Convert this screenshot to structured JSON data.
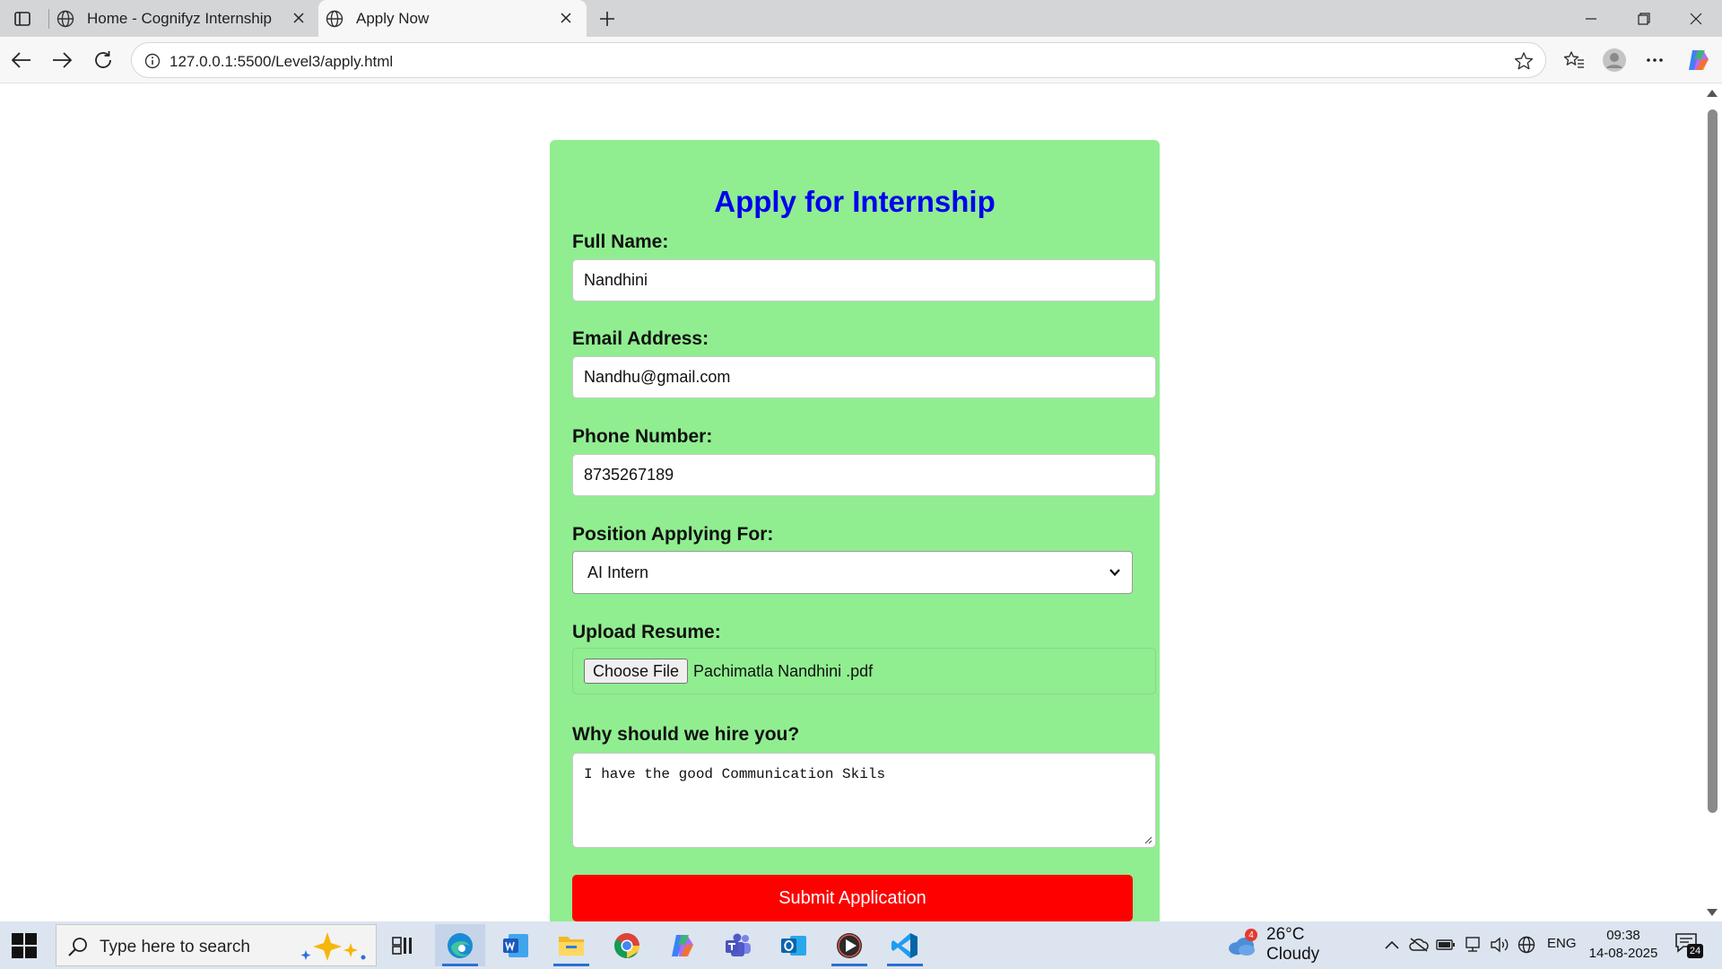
{
  "browser": {
    "tabs": [
      {
        "title": "Home - Cognifyz Internship",
        "icon": "globe-icon",
        "active": false
      },
      {
        "title": "Apply Now",
        "icon": "globe-icon",
        "active": true
      }
    ],
    "url": "127.0.0.1:5500/Level3/apply.html"
  },
  "form": {
    "title": "Apply for Internship",
    "full_name_label": "Full Name:",
    "full_name_value": "Nandhini",
    "email_label": "Email Address:",
    "email_value": "Nandhu@gmail.com",
    "phone_label": "Phone Number:",
    "phone_value": "8735267189",
    "position_label": "Position Applying For:",
    "position_value": "AI Intern",
    "resume_label": "Upload Resume:",
    "resume_button": "Choose File",
    "resume_file": "Pachimatla Nandhini .pdf",
    "why_label": "Why should we hire you?",
    "why_value": "I have the good Communication Skils",
    "submit_label": "Submit Application",
    "colors": {
      "card": "#90ee90",
      "title": "#0000ee",
      "submit": "#ff0000"
    }
  },
  "taskbar": {
    "search_placeholder": "Type here to search",
    "weather_badge": "4",
    "weather": "26°C  Cloudy",
    "language": "ENG",
    "time": "09:38",
    "date": "14-08-2025",
    "notification_count": "24",
    "apps": [
      "edge-icon",
      "word-icon",
      "file-explorer-icon",
      "chrome-icon",
      "copilot-icon",
      "teams-icon",
      "outlook-icon",
      "media-player-icon",
      "vscode-icon"
    ]
  }
}
